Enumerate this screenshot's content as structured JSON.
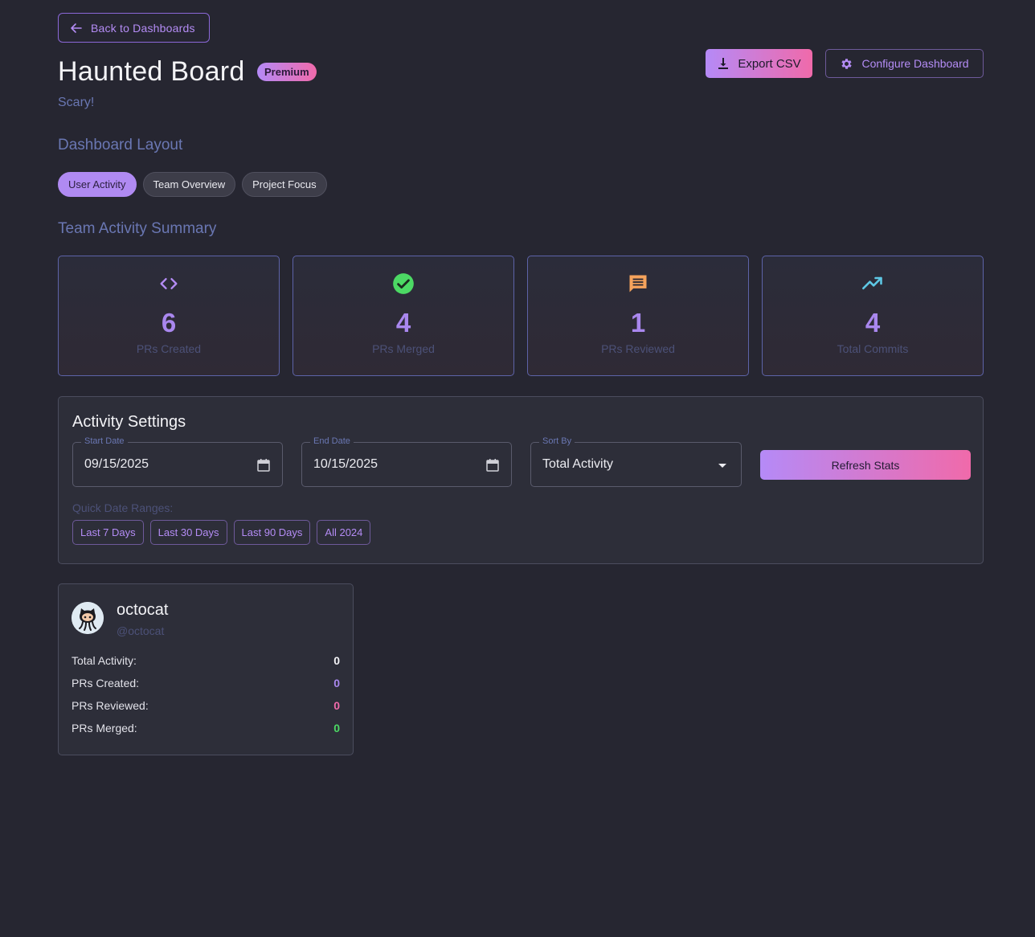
{
  "nav": {
    "back_label": "Back to Dashboards"
  },
  "dashboard": {
    "title": "Haunted Board",
    "badge": "Premium",
    "subtitle": "Scary!"
  },
  "actions": {
    "export_label": "Export CSV",
    "configure_label": "Configure Dashboard"
  },
  "layout": {
    "heading": "Dashboard Layout",
    "tabs": [
      {
        "label": "User Activity",
        "active": true
      },
      {
        "label": "Team Overview",
        "active": false
      },
      {
        "label": "Project Focus",
        "active": false
      }
    ]
  },
  "summary": {
    "heading": "Team Activity Summary",
    "stats": [
      {
        "icon": "code-icon",
        "value": "6",
        "label": "PRs Created",
        "icon_color": "#b48cf5"
      },
      {
        "icon": "check-circle-icon",
        "value": "4",
        "label": "PRs Merged",
        "icon_color": "#4cd964"
      },
      {
        "icon": "comment-icon",
        "value": "1",
        "label": "PRs Reviewed",
        "icon_color": "#f5a35c"
      },
      {
        "icon": "trending-up-icon",
        "value": "4",
        "label": "Total Commits",
        "icon_color": "#5ec8e5"
      }
    ]
  },
  "settings": {
    "title": "Activity Settings",
    "start_date": {
      "label": "Start Date",
      "value": "09/15/2025"
    },
    "end_date": {
      "label": "End Date",
      "value": "10/15/2025"
    },
    "sort_by": {
      "label": "Sort By",
      "value": "Total Activity"
    },
    "refresh_label": "Refresh Stats",
    "quick_label": "Quick Date Ranges:",
    "quick_ranges": [
      "Last 7 Days",
      "Last 30 Days",
      "Last 90 Days",
      "All 2024"
    ]
  },
  "user": {
    "name": "octocat",
    "handle": "@octocat",
    "metrics": [
      {
        "label": "Total Activity:",
        "value": "0",
        "color": "#f3f3f6"
      },
      {
        "label": "PRs Created:",
        "value": "0",
        "color": "#a987ee"
      },
      {
        "label": "PRs Reviewed:",
        "value": "0",
        "color": "#f06aaa"
      },
      {
        "label": "PRs Merged:",
        "value": "0",
        "color": "#4cd964"
      }
    ]
  },
  "colors": {
    "accent": "#b48cf5",
    "gradient_start": "#b58af7",
    "gradient_end": "#f06aaa",
    "background": "#262631"
  }
}
